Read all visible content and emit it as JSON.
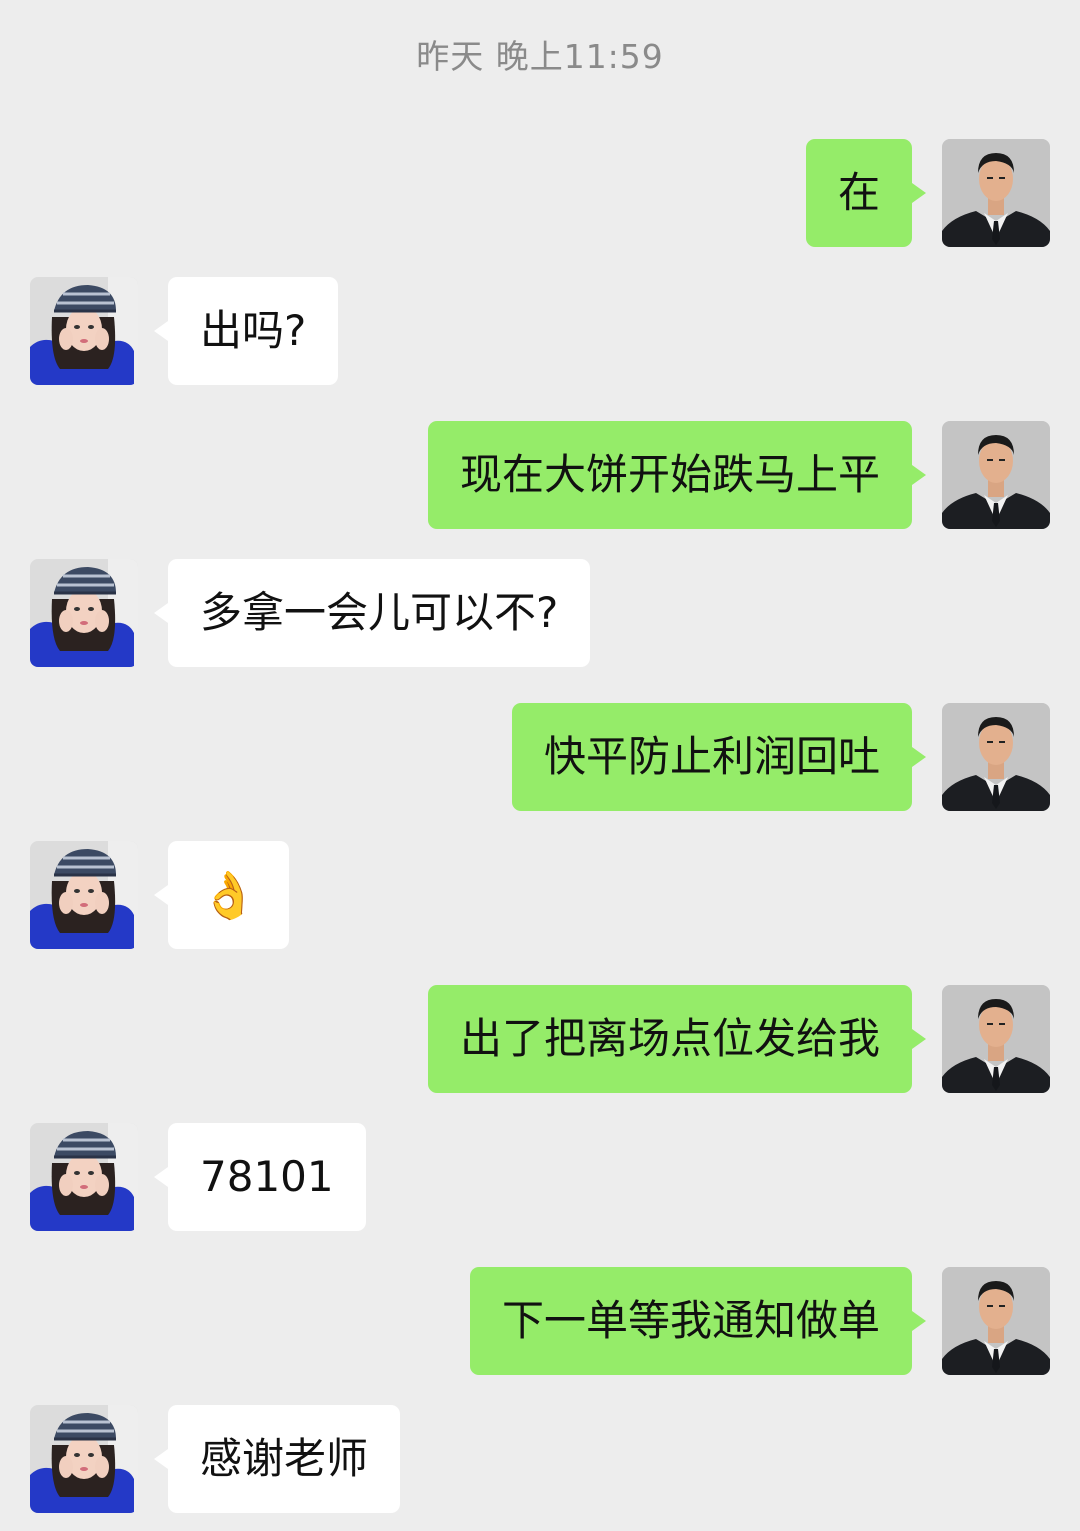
{
  "chat": {
    "timestamp": "昨天 晚上11:59",
    "messages": [
      {
        "side": "out",
        "text": "在"
      },
      {
        "side": "in",
        "text": "出吗?"
      },
      {
        "side": "out",
        "text": "现在大饼开始跌马上平"
      },
      {
        "side": "in",
        "text": "多拿一会儿可以不?"
      },
      {
        "side": "out",
        "text": "快平防止利润回吐"
      },
      {
        "side": "in",
        "text": "👌"
      },
      {
        "side": "out",
        "text": "出了把离场点位发给我"
      },
      {
        "side": "in",
        "text": "78101"
      },
      {
        "side": "out",
        "text": "下一单等我通知做单"
      },
      {
        "side": "in",
        "text": "感谢老师"
      }
    ]
  },
  "colors": {
    "background": "#ededed",
    "outgoing_bubble": "#95ec69",
    "incoming_bubble": "#ffffff",
    "timestamp_text": "#8a8a8a"
  },
  "icons": {
    "outgoing_avatar": "man-in-suit-avatar",
    "incoming_avatar": "woman-in-striped-hat-avatar"
  }
}
